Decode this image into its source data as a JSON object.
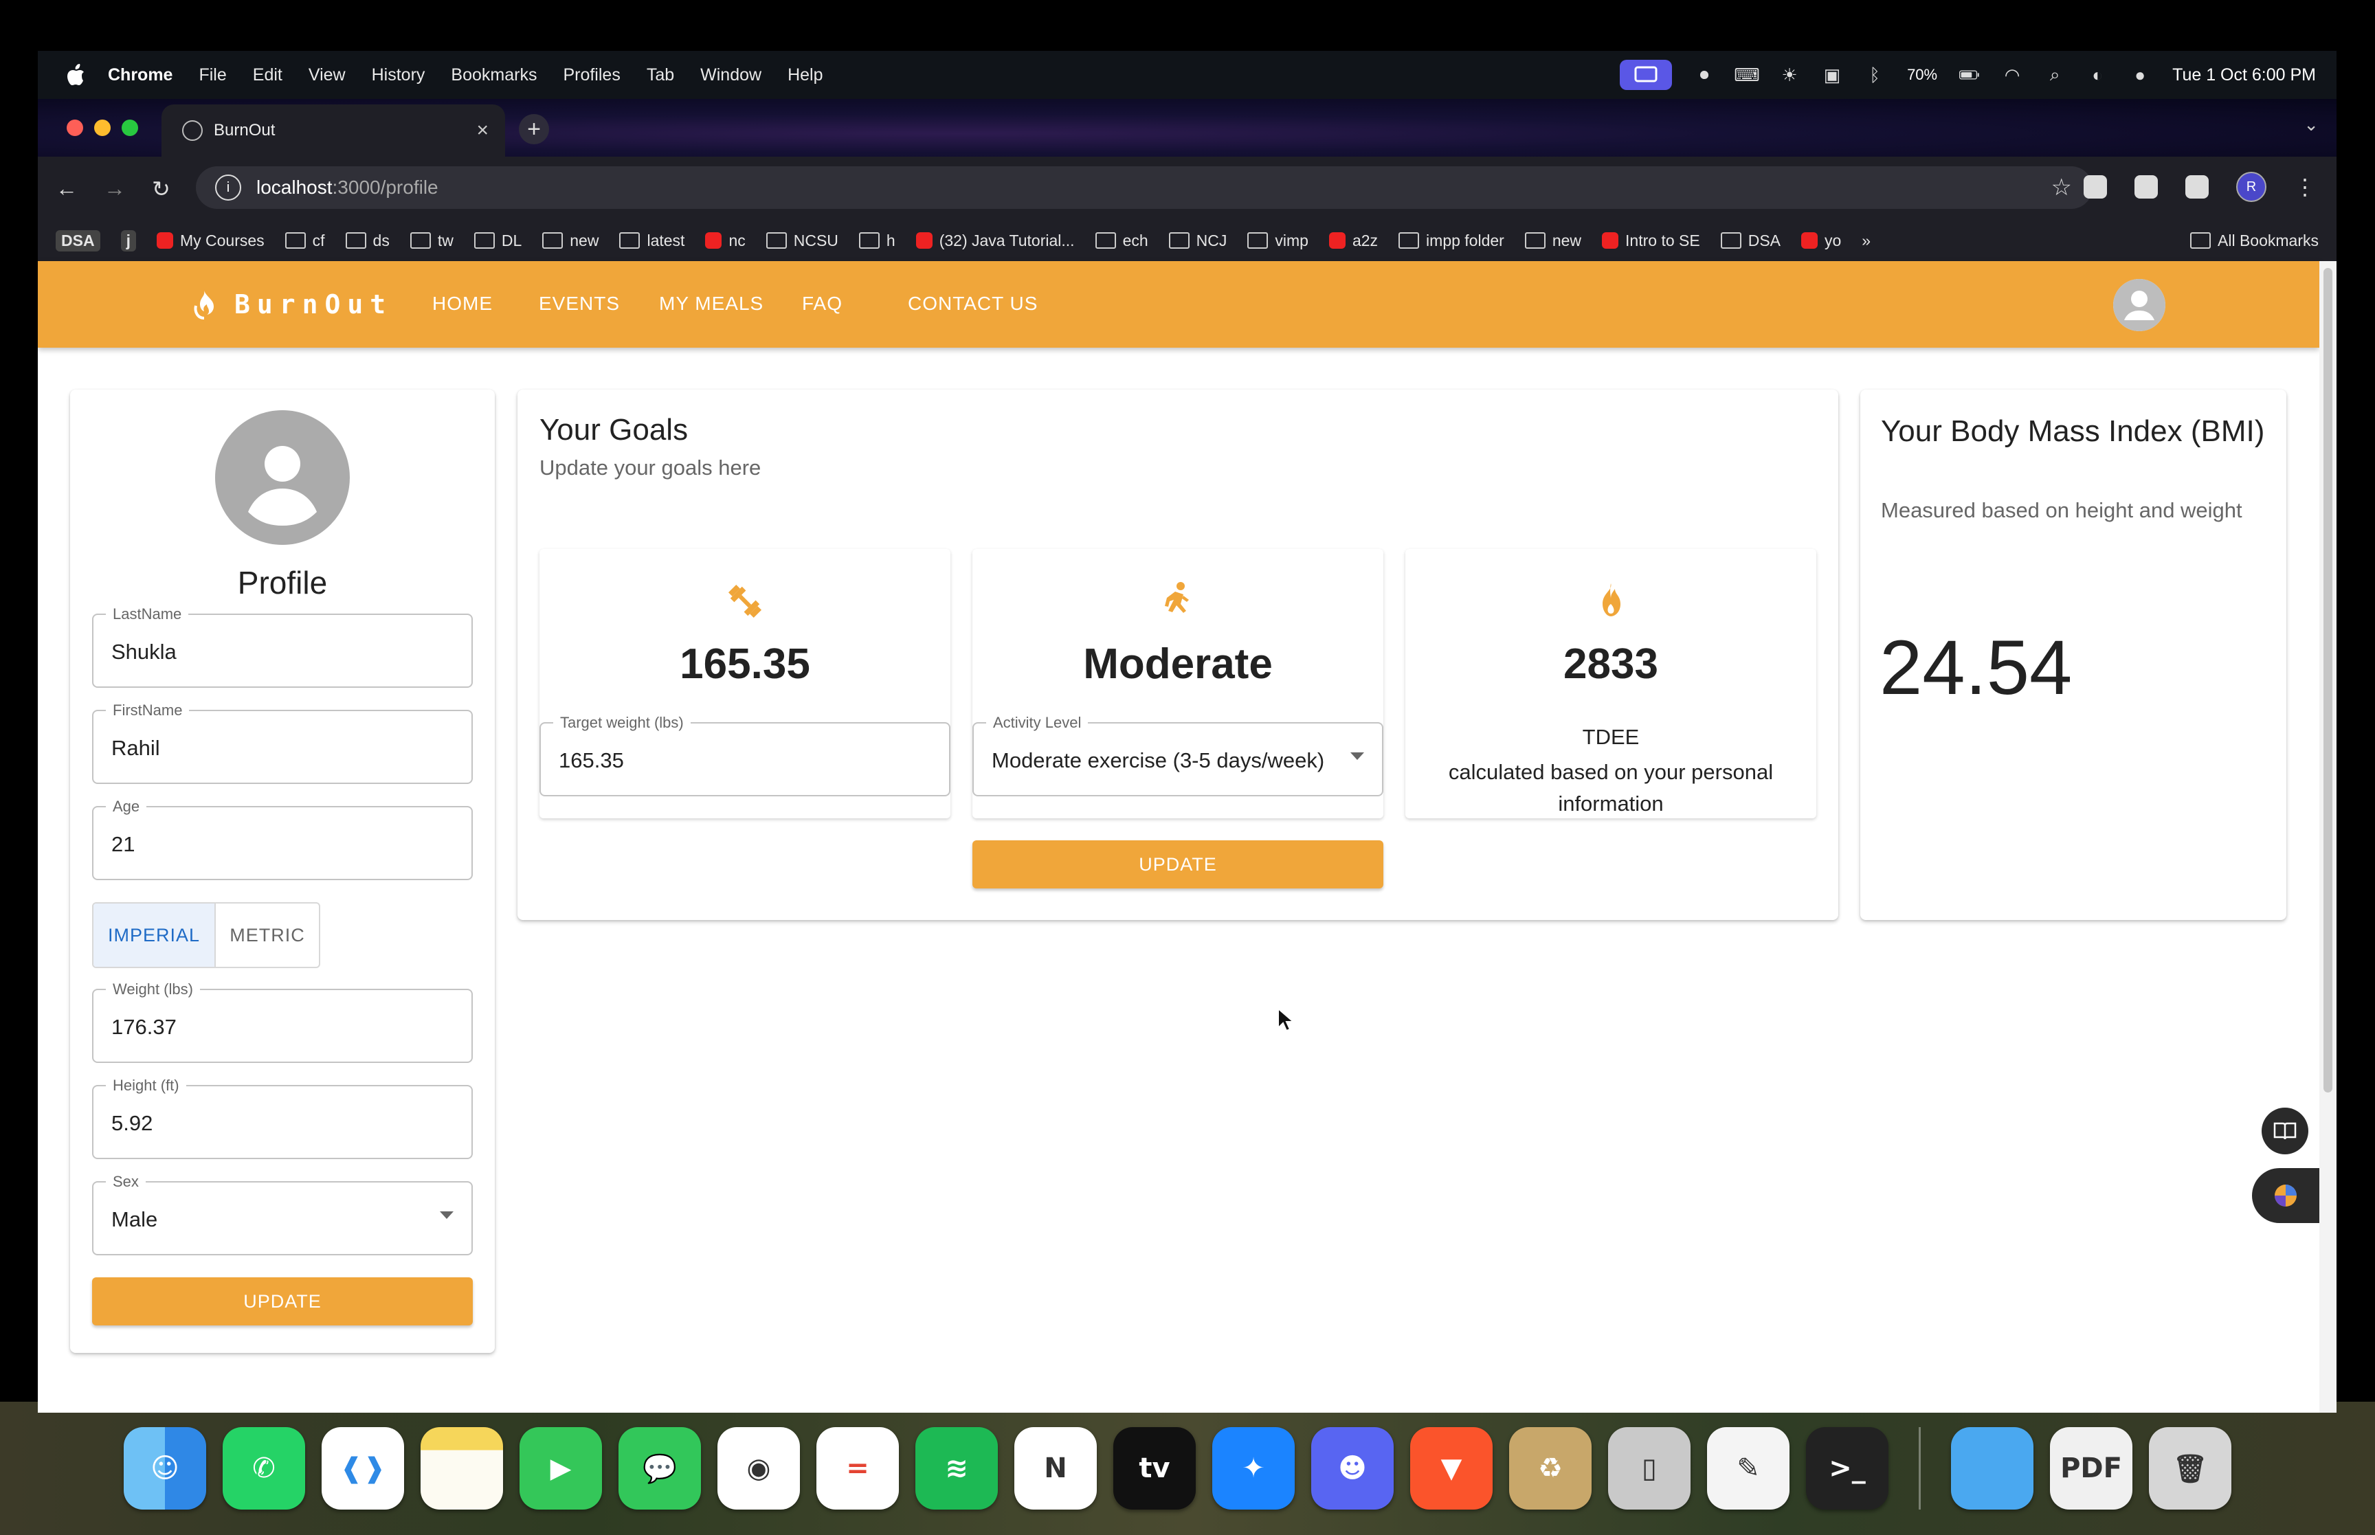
{
  "menubar": {
    "app": "Chrome",
    "items": [
      "File",
      "Edit",
      "View",
      "History",
      "Bookmarks",
      "Profiles",
      "Tab",
      "Window",
      "Help"
    ],
    "battery": "70%",
    "datetime": "Tue 1 Oct  6:00 PM"
  },
  "browser": {
    "tab_title": "BurnOut",
    "url_host": "localhost",
    "url_path": ":3000/profile",
    "profile_initial": "R",
    "bookmarks": [
      {
        "label": "DSA",
        "kind": "badge"
      },
      {
        "label": "j",
        "kind": "badge"
      },
      {
        "label": "My Courses",
        "kind": "site"
      },
      {
        "label": "cf",
        "kind": "folder"
      },
      {
        "label": "ds",
        "kind": "folder"
      },
      {
        "label": "tw",
        "kind": "folder"
      },
      {
        "label": "DL",
        "kind": "folder"
      },
      {
        "label": "new",
        "kind": "folder"
      },
      {
        "label": "latest",
        "kind": "folder"
      },
      {
        "label": "nc",
        "kind": "site"
      },
      {
        "label": "NCSU",
        "kind": "folder"
      },
      {
        "label": "h",
        "kind": "folder"
      },
      {
        "label": "(32) Java Tutorial...",
        "kind": "site"
      },
      {
        "label": "ech",
        "kind": "folder"
      },
      {
        "label": "NCJ",
        "kind": "folder"
      },
      {
        "label": "vimp",
        "kind": "folder"
      },
      {
        "label": "a2z",
        "kind": "site"
      },
      {
        "label": "impp folder",
        "kind": "folder"
      },
      {
        "label": "new",
        "kind": "folder"
      },
      {
        "label": "Intro to SE",
        "kind": "site"
      },
      {
        "label": "DSA",
        "kind": "folder"
      },
      {
        "label": "yo",
        "kind": "site"
      }
    ],
    "more": "»",
    "all_bookmarks": "All Bookmarks"
  },
  "app": {
    "brand": "BurnOut",
    "nav": [
      "HOME",
      "EVENTS",
      "MY MEALS",
      "FAQ",
      "CONTACT US"
    ]
  },
  "profile": {
    "title": "Profile",
    "last_name": {
      "label": "LastName",
      "value": "Shukla"
    },
    "first_name": {
      "label": "FirstName",
      "value": "Rahil"
    },
    "age": {
      "label": "Age",
      "value": "21"
    },
    "units": {
      "imperial": "IMPERIAL",
      "metric": "METRIC",
      "selected": "IMPERIAL"
    },
    "weight": {
      "label": "Weight (lbs)",
      "value": "176.37"
    },
    "height": {
      "label": "Height (ft)",
      "value": "5.92"
    },
    "sex": {
      "label": "Sex",
      "value": "Male"
    },
    "update": "UPDATE"
  },
  "goals": {
    "title": "Your Goals",
    "subtitle": "Update your goals here",
    "target": {
      "value": "165.35",
      "label": "Target weight (lbs)",
      "input": "165.35"
    },
    "activity": {
      "value": "Moderate",
      "label": "Activity Level",
      "input": "Moderate exercise (3-5 days/week)"
    },
    "tdee": {
      "value": "2833",
      "label": "TDEE",
      "desc": "calculated based on your personal information"
    },
    "update": "UPDATE"
  },
  "bmi": {
    "title": "Your Body Mass Index (BMI)",
    "subtitle": "Measured based on height and weight",
    "value": "24.54"
  },
  "colors": {
    "brand": "#f0a63a",
    "selected_toggle": "#1f6bc6"
  },
  "dock": [
    "finder",
    "whatsapp",
    "vscode",
    "notes",
    "facetime",
    "messages",
    "chrome",
    "todoist",
    "spotify",
    "notion",
    "apple-tv",
    "safari",
    "discord",
    "brave",
    "archive-utility",
    "iphone-mirroring",
    "textedit",
    "terminal",
    "folder",
    "pdf-document",
    "trash"
  ]
}
